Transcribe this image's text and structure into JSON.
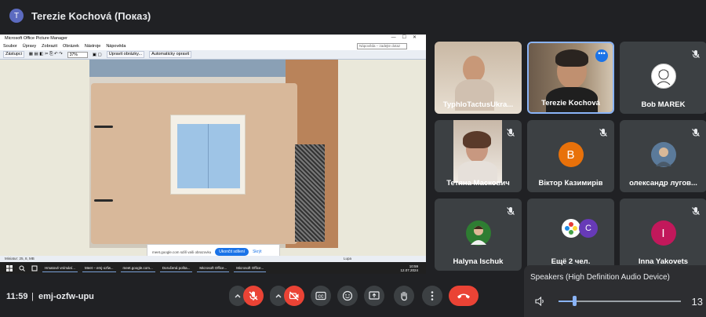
{
  "top": {
    "avatar_letter": "T",
    "title": "Terezie Kochová (Показ)"
  },
  "shared_window": {
    "title": "Microsoft Office Picture Manager",
    "menu": [
      "Soubor",
      "Úpravy",
      "Zobrazit",
      "Obrázek",
      "Nástroje",
      "Nápověda"
    ],
    "help_placeholder": "Nápověda – zadejte dotaz",
    "toolbar": {
      "shortcuts": "Zástupci",
      "zoom": "37%",
      "edit": "Upravit obrázky...",
      "autofix": "Automaticky opravit"
    },
    "notify": {
      "text": "meet.google.com sdílí vaši obrazovku",
      "stop": "Ukončit sdílení",
      "hide": "Skrýt"
    },
    "status_left": "Miniatur: 25, 8,  MB",
    "status_zoom": "Lupa",
    "taskbar": [
      "Hmatové vnímání...",
      "Meet – emj-ozfw...",
      "meet.google.com...",
      "Doručená pošta...",
      "Microsoft Office...",
      "Microsoft Office..."
    ],
    "clock": {
      "time": "10:59",
      "date": "12.07.2024"
    }
  },
  "participants": [
    {
      "name": "TyphloTactusUkra...",
      "type": "video",
      "muted": false
    },
    {
      "name": "Terezie Kochová",
      "type": "video",
      "muted": false,
      "active": true
    },
    {
      "name": "Bob MAREK",
      "type": "avatar-img",
      "muted": true
    },
    {
      "name": "Тетяна Маскович",
      "type": "video",
      "muted": true
    },
    {
      "name": "Віктор Казимирів",
      "type": "letter",
      "letter": "B",
      "color": "#e8710a",
      "muted": true
    },
    {
      "name": "олександр лугов...",
      "type": "avatar-img",
      "muted": true
    },
    {
      "name": "Halyna Ischuk",
      "type": "avatar-img",
      "muted": true
    },
    {
      "name": "Ещё 2 чел.",
      "type": "group",
      "letter": "C",
      "color": "#673ab7",
      "muted": false
    },
    {
      "name": "Inna Yakovets",
      "type": "letter",
      "letter": "I",
      "color": "#c2185b",
      "muted": true
    }
  ],
  "bottom": {
    "time": "11:59",
    "separator": "|",
    "code": "emj-ozfw-upu"
  },
  "speaker_popup": {
    "device": "Speakers (High Definition Audio Device)",
    "volume": "13",
    "level": 0.13
  },
  "colors": {
    "accent": "#8ab4f8",
    "danger": "#ea4335",
    "bg": "#202124",
    "tile": "#3c4043"
  }
}
